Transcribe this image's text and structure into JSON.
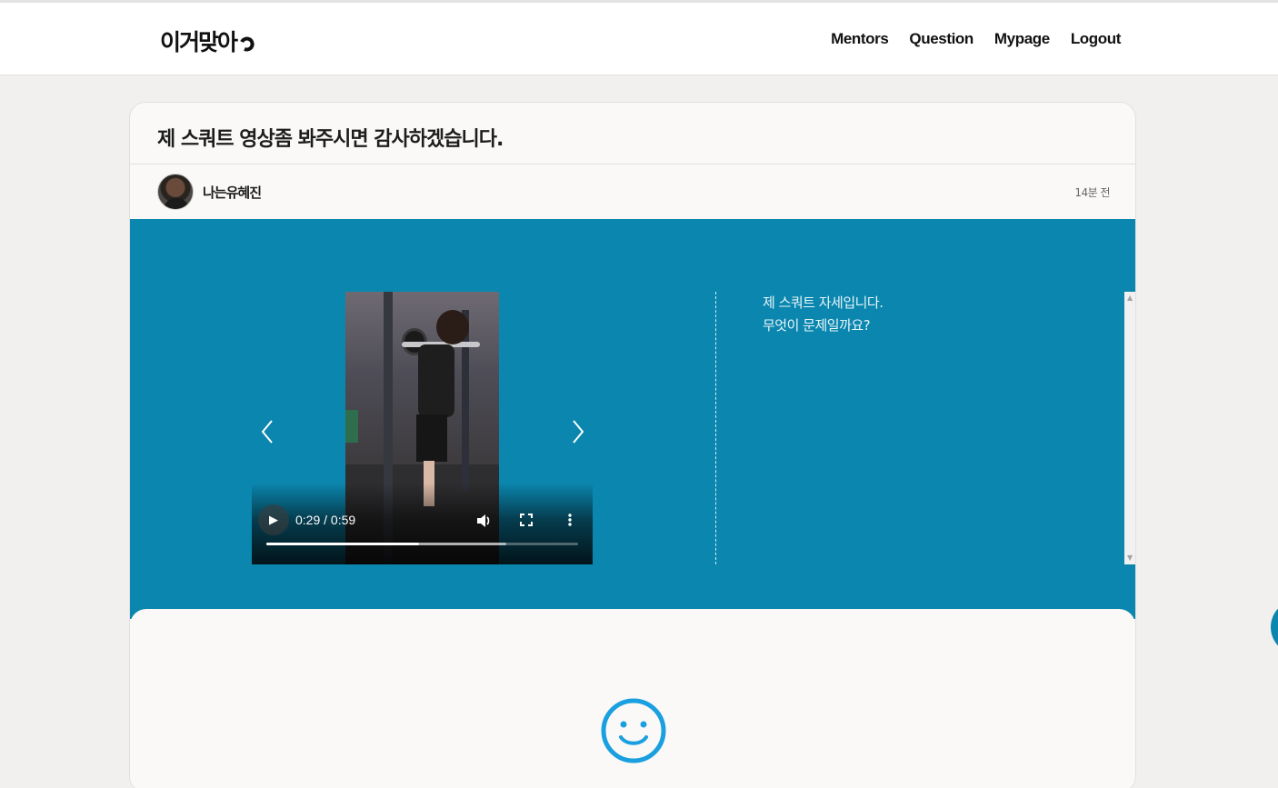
{
  "header": {
    "logo": "이거맞아",
    "nav": [
      "Mentors",
      "Question",
      "Mypage",
      "Logout"
    ]
  },
  "post": {
    "title": "제 스쿼트 영상좀 봐주시면 감사하겠습니다.",
    "author": "나는유혜진",
    "time": "14분 전",
    "description_lines": [
      "제 스쿼트 자세입니다.",
      "무엇이 문제일까요?"
    ]
  },
  "video": {
    "current_time": "0:29",
    "duration": "0:59",
    "time_readout": "0:29 / 0:59",
    "progress_fraction": 0.49,
    "buffered_fraction": 0.77
  },
  "colors": {
    "accent_band": "#0b86ae",
    "smiley": "#1a9fe0"
  },
  "icons": {
    "play": "play-icon",
    "volume": "volume-icon",
    "fullscreen": "fullscreen-icon",
    "more": "more-vertical-icon",
    "prev": "chevron-left-icon",
    "next": "chevron-right-icon",
    "smiley": "smiley-icon"
  }
}
